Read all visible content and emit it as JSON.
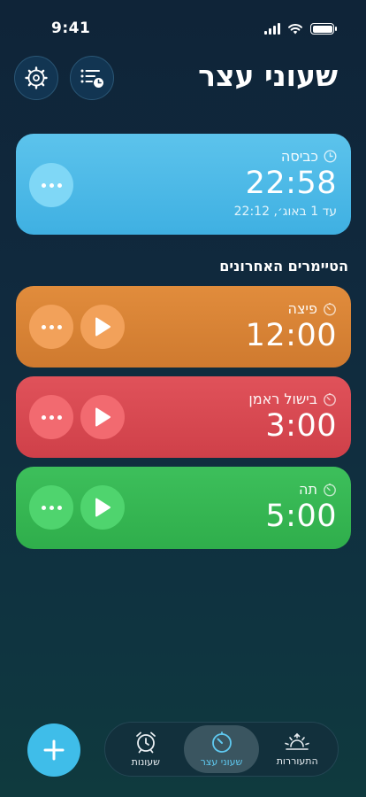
{
  "status": {
    "time": "9:41"
  },
  "header": {
    "title": "שעוני עצר",
    "settings_icon": "gear-icon",
    "list_icon": "list-clock-icon"
  },
  "active_timer": {
    "name": "כביסה",
    "time": "22:58",
    "until": "עד 1 באוג׳, 22:12",
    "color": "#4db9e8"
  },
  "recent": {
    "title": "הטיימרים האחרונים",
    "items": [
      {
        "name": "פיצה",
        "time": "12:00",
        "color": "#d9843a"
      },
      {
        "name": "בישול ראמן",
        "time": "3:00",
        "color": "#d84a52"
      },
      {
        "name": "תה",
        "time": "5:00",
        "color": "#37b754"
      }
    ]
  },
  "tabs": [
    {
      "label": "התעוררות",
      "icon": "sunrise-icon"
    },
    {
      "label": "שעוני עצר",
      "icon": "timer-icon",
      "active": true
    },
    {
      "label": "שעונות",
      "icon": "alarm-clock-icon"
    }
  ],
  "fab": {
    "icon": "plus-icon",
    "color": "#3fbde9"
  }
}
